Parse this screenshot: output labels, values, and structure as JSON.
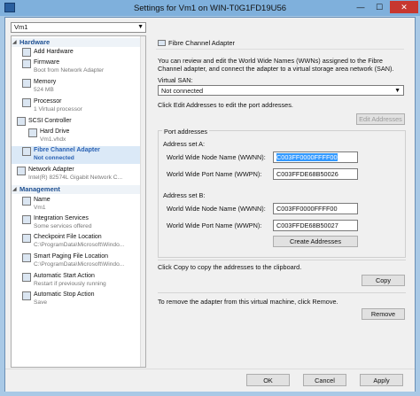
{
  "window": {
    "title": "Settings for Vm1 on WIN-T0G1FD19U56",
    "minimize": "—",
    "maximize": "☐",
    "close": "✕"
  },
  "vm_selector": {
    "value": "Vm1"
  },
  "tree": {
    "hardware_header": "Hardware",
    "management_header": "Management",
    "hardware_items": [
      {
        "name": "Add Hardware",
        "sub": "",
        "icon": "add-hardware-icon"
      },
      {
        "name": "Firmware",
        "sub": "Boot from Network Adapter",
        "icon": "firmware-icon"
      },
      {
        "name": "Memory",
        "sub": "524 MB",
        "icon": "memory-icon"
      },
      {
        "name": "Processor",
        "sub": "1 Virtual processor",
        "icon": "processor-icon"
      },
      {
        "name": "SCSI Controller",
        "sub": "",
        "icon": "scsi-controller-icon"
      },
      {
        "name": "Hard Drive",
        "sub": "Vm1.vhdx",
        "icon": "hard-drive-icon"
      },
      {
        "name": "Fibre Channel Adapter",
        "sub": "Not connected",
        "icon": "fibre-channel-icon"
      },
      {
        "name": "Network Adapter",
        "sub": "Intel(R) 82574L Gigabit Network C...",
        "icon": "network-adapter-icon"
      }
    ],
    "management_items": [
      {
        "name": "Name",
        "sub": "Vm1",
        "icon": "name-icon"
      },
      {
        "name": "Integration Services",
        "sub": "Some services offered",
        "icon": "integration-services-icon"
      },
      {
        "name": "Checkpoint File Location",
        "sub": "C:\\ProgramData\\Microsoft\\Windo...",
        "icon": "checkpoint-icon"
      },
      {
        "name": "Smart Paging File Location",
        "sub": "C:\\ProgramData\\Microsoft\\Windo...",
        "icon": "smart-paging-icon"
      },
      {
        "name": "Automatic Start Action",
        "sub": "Restart if previously running",
        "icon": "auto-start-icon"
      },
      {
        "name": "Automatic Stop Action",
        "sub": "Save",
        "icon": "auto-stop-icon"
      }
    ]
  },
  "panel": {
    "header": "Fibre Channel Adapter",
    "description": "You can review and edit the World Wide Names (WWNs) assigned to the Fibre Channel adapter, and connect the adapter to a virtual storage area network (SAN).",
    "virtual_san_label": "Virtual SAN:",
    "virtual_san_value": "Not connected",
    "edit_addresses_text": "Click Edit Addresses to edit the port addresses.",
    "edit_addresses_button": "Edit Addresses",
    "port_addresses_label": "Port addresses",
    "set_a_label": "Address set A:",
    "set_b_label": "Address set B:",
    "wwnn_label": "World Wide Node Name (WWNN):",
    "wwpn_label": "World Wide Port Name (WWPN):",
    "set_a_wwnn": "C003FF0000FFFF00",
    "set_a_wwpn": "C003FFDE68B50026",
    "set_b_wwnn": "C003FF0000FFFF00",
    "set_b_wwpn": "C003FFDE68B50027",
    "create_addresses_button": "Create Addresses",
    "copy_text": "Click Copy to copy the addresses to the clipboard.",
    "copy_button": "Copy",
    "remove_text": "To remove the adapter from this virtual machine, click Remove.",
    "remove_button": "Remove"
  },
  "footer": {
    "ok": "OK",
    "cancel": "Cancel",
    "apply": "Apply"
  }
}
